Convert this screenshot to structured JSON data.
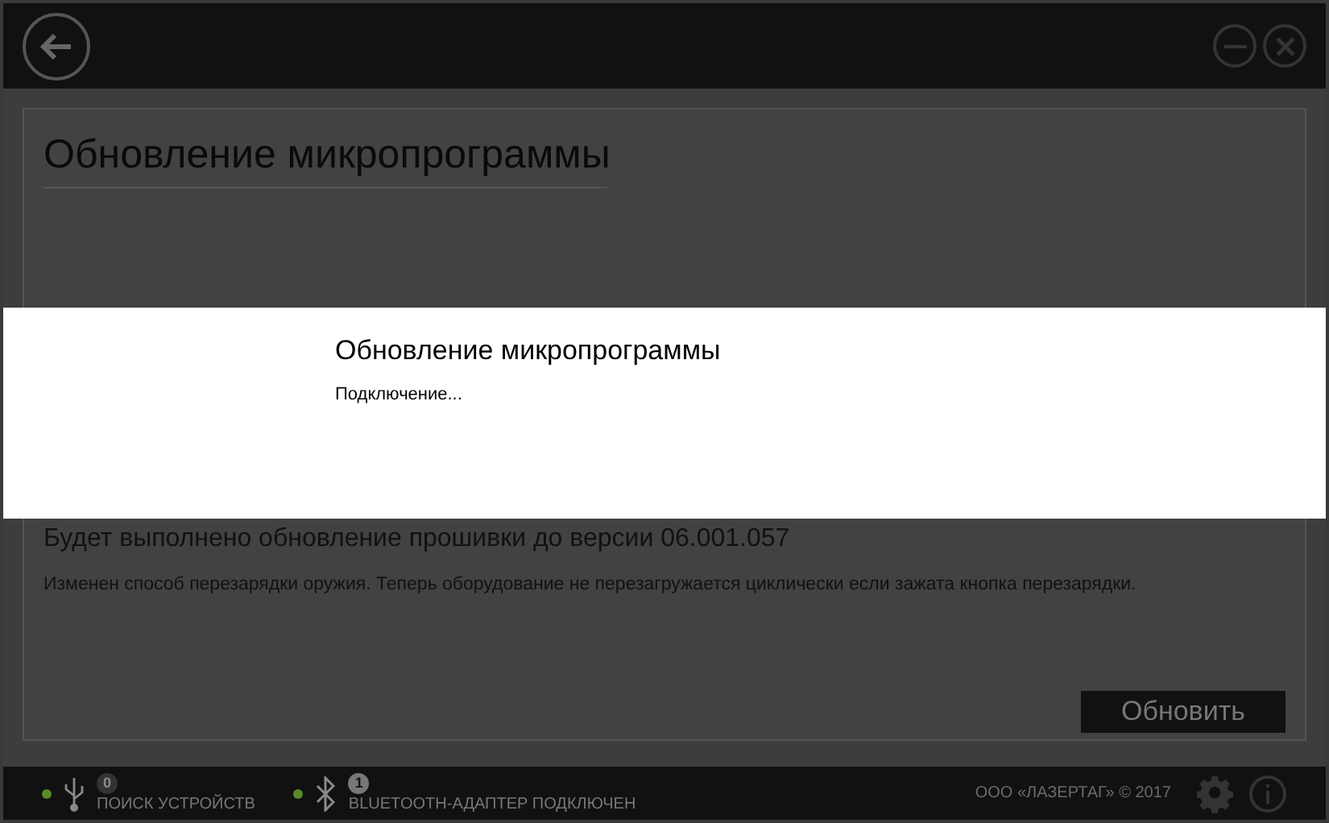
{
  "page": {
    "title": "Обновление микропрограммы",
    "update_heading": "Будет выполнено обновление прошивки до версии  06.001.057",
    "update_notes": "Изменен способ перезарядки оружия. Теперь оборудование не перезагружается циклически если зажата кнопка перезарядки.",
    "update_button": "Обновить"
  },
  "dialog": {
    "title": "Обновление микропрограммы",
    "status": "Подключение..."
  },
  "status_bar": {
    "items": [
      {
        "kind": "usb",
        "color": "#5a8a2a",
        "count": "0",
        "active": false,
        "label": "ПОИСК УСТРОЙСТВ"
      },
      {
        "kind": "bluetooth",
        "color": "#5a8a2a",
        "count": "1",
        "active": true,
        "label": "BLUETOOTH-АДАПТЕР ПОДКЛЮЧЕН"
      }
    ],
    "copyright": "ООО «ЛАЗЕРТАГ» © 2017"
  }
}
